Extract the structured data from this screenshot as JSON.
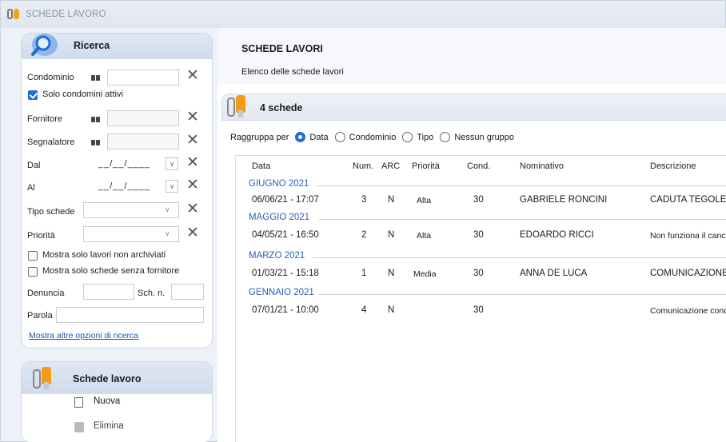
{
  "window": {
    "title": "SCHEDE LAVORO"
  },
  "search": {
    "title": "Ricerca",
    "condominio_label": "Condominio",
    "solo_attivi_label": "Solo condomini attivi",
    "fornitore_label": "Fornitore",
    "segnalatore_label": "Segnalatore",
    "dal_label": "Dal",
    "al_label": "Al",
    "date_mask": "__/__/____",
    "tipo_schede_label": "Tipo schede",
    "priorita_label": "Priorità",
    "non_archiviati_label": "Mostra solo lavori non archiviati",
    "senza_fornitore_label": "Mostra solo schede senza fornitore",
    "denuncia_label": "Denuncia",
    "sch_n_label": "Sch. n.",
    "parola_label": "Parola",
    "more_options_link": "Mostra altre opzioni di ricerca"
  },
  "actions_panel": {
    "title": "Schede lavoro",
    "new_label": "Nuova",
    "delete_label": "Elimina"
  },
  "main": {
    "title": "SCHEDE LAVORI",
    "subtitle": "Elenco delle schede lavori",
    "group_title": "4 schede",
    "group_by_label": "Raggruppa per",
    "group_options": [
      "Data",
      "Condominio",
      "Tipo",
      "Nessun gruppo"
    ],
    "group_selected": "Data"
  },
  "table": {
    "columns": [
      "Data",
      "Num.",
      "ARC",
      "Priorità",
      "Cond.",
      "Nominativo",
      "Descrizione"
    ],
    "groups": [
      {
        "label": "GIUGNO 2021",
        "rows": [
          [
            "06/06/21 - 17:07",
            "3",
            "N",
            "Alta",
            "30",
            "GABRIELE RONCINI",
            "CADUTA TEGOLE"
          ]
        ]
      },
      {
        "label": "MAGGIO 2021",
        "rows": [
          [
            "04/05/21 - 16:50",
            "2",
            "N",
            "Alta",
            "30",
            "EDOARDO RICCI",
            "Non funziona il cancello"
          ]
        ]
      },
      {
        "label": "MARZO 2021",
        "rows": [
          [
            "01/03/21 - 15:18",
            "1",
            "N",
            "Media",
            "30",
            "ANNA DE LUCA",
            "COMUNICAZIONE"
          ]
        ]
      },
      {
        "label": "GENNAIO 2021",
        "rows": [
          [
            "07/01/21 - 10:00",
            "4",
            "N",
            "",
            "30",
            "",
            "Comunicazione condomini"
          ]
        ]
      }
    ]
  },
  "colors": {
    "accent": "#1f6fd1",
    "group_label": "#2b5fb8",
    "link": "#1f50b8",
    "tool_orange": "#f39b14"
  }
}
